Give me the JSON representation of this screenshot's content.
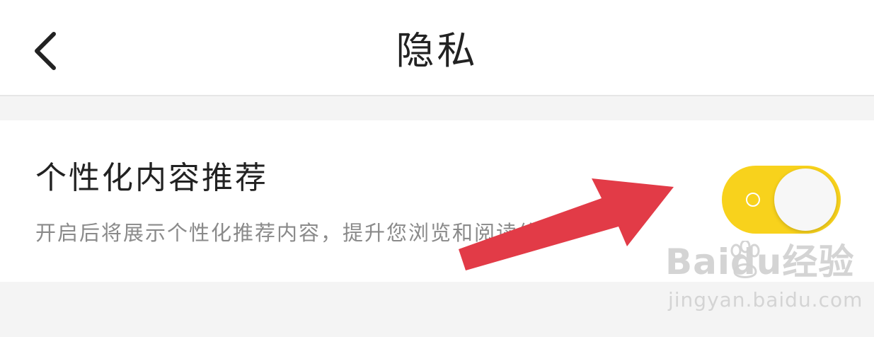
{
  "header": {
    "title": "隐私",
    "back_icon": "chevron-left-icon"
  },
  "setting": {
    "title": "个性化内容推荐",
    "description": "开启后将展示个性化推荐内容，提升您浏览和阅读体验",
    "enabled": true,
    "toggle_color": "#f8d21c"
  },
  "annotation": {
    "arrow_color": "#e23b47",
    "points_to": "toggle"
  },
  "watermark": {
    "logo": "Baidu经验",
    "site": "jingyan.baidu.com"
  }
}
